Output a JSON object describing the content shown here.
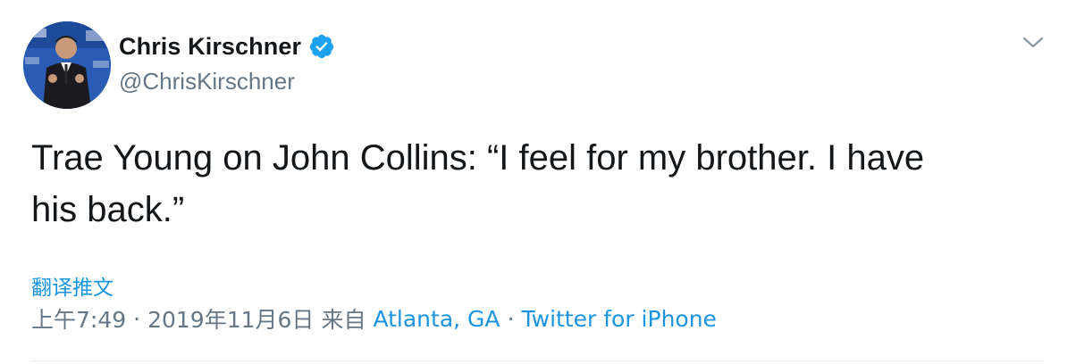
{
  "user": {
    "display_name": "Chris Kirschner",
    "handle": "@ChrisKirschner",
    "verified": true
  },
  "tweet": {
    "text_line1": "Trae Young on John Collins: “I feel for my brother. I have",
    "text_line2": "his back.”",
    "translate_label": "翻译推文"
  },
  "meta": {
    "time": "上午7:49",
    "date": "2019年11月6日",
    "from_label": "来自",
    "location": "Atlanta, GA",
    "source": "Twitter for iPhone",
    "separator": "·"
  },
  "colors": {
    "link": "#1b95e0",
    "text": "#14171a",
    "secondary": "#657786",
    "verified": "#1da1f2"
  },
  "icons": {
    "verified": "verified-badge-icon",
    "caret": "chevron-down-icon"
  }
}
